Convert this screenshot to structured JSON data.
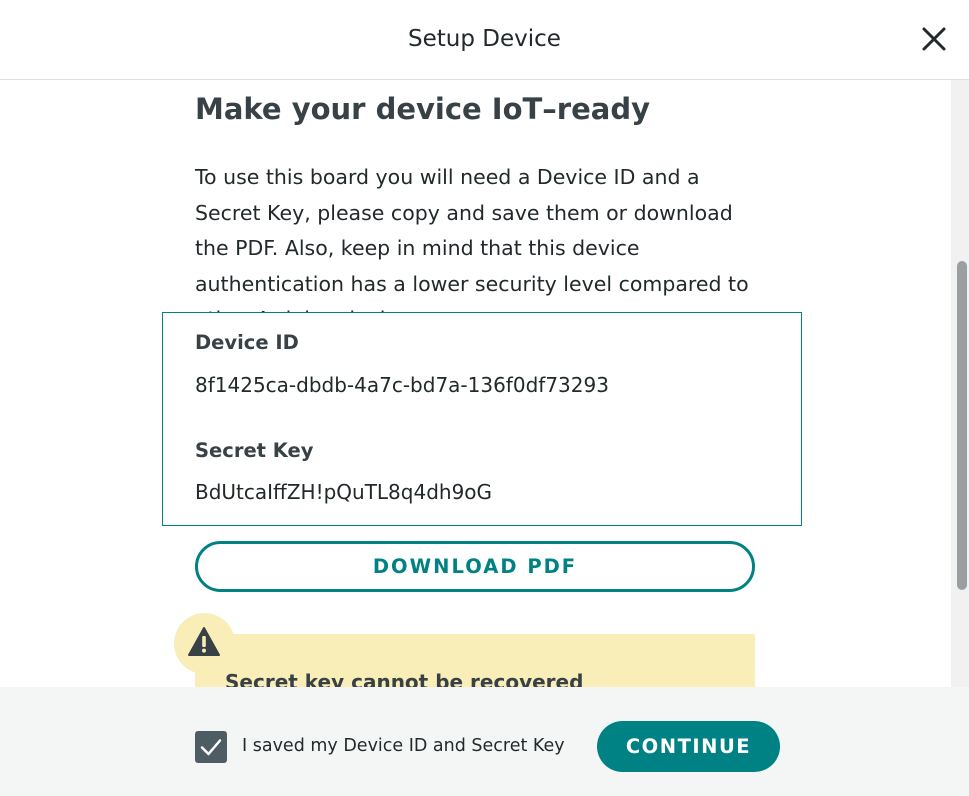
{
  "header": {
    "title": "Setup Device",
    "close_icon": "close-icon"
  },
  "main": {
    "heading": "Make your device IoT–ready",
    "description": "To use this board you will need a Device ID and a Secret Key, please copy and save them or download the PDF. Also, keep in mind that this device authentication has a lower security level compared to other Arduino devices.",
    "credentials": {
      "device_id_label": "Device ID",
      "device_id_value": "8f1425ca-dbdb-4a7c-bd7a-136f0df73293",
      "secret_key_label": "Secret Key",
      "secret_key_value": "BdUtcaIffZH!pQuTL8q4dh9oG"
    },
    "download_label": "DOWNLOAD PDF",
    "warning": {
      "icon": "warning-icon",
      "text": "Secret key cannot be recovered"
    }
  },
  "footer": {
    "checkbox_label": "I saved my Device ID and Secret Key",
    "checkbox_checked": true,
    "continue_label": "CONTINUE"
  },
  "colors": {
    "accent": "#008184",
    "warning_bg": "#f9edb8",
    "footer_bg": "#f4f6f6",
    "text_dark": "#374146"
  }
}
